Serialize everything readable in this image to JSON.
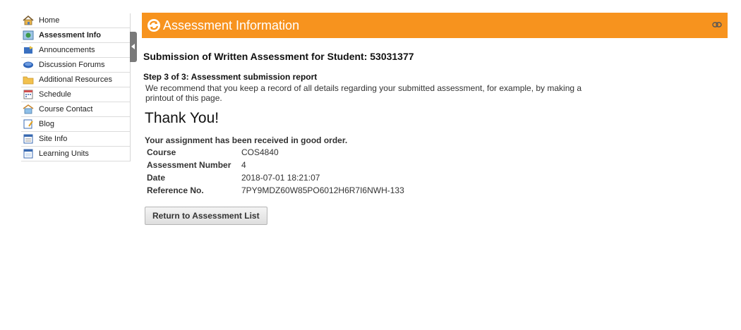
{
  "sidebar": {
    "items": [
      {
        "label": "Home",
        "icon": "home-icon"
      },
      {
        "label": "Assessment Info",
        "icon": "assessment-icon",
        "active": true
      },
      {
        "label": "Announcements",
        "icon": "announcements-icon"
      },
      {
        "label": "Discussion Forums",
        "icon": "forums-icon"
      },
      {
        "label": "Additional Resources",
        "icon": "folder-icon"
      },
      {
        "label": "Schedule",
        "icon": "calendar-icon"
      },
      {
        "label": "Course Contact",
        "icon": "contact-icon"
      },
      {
        "label": "Blog",
        "icon": "blog-icon"
      },
      {
        "label": "Site Info",
        "icon": "info-icon"
      },
      {
        "label": "Learning Units",
        "icon": "units-icon"
      }
    ]
  },
  "header": {
    "title": "Assessment Information",
    "color": "#f7931e"
  },
  "main": {
    "subtitle": "Submission of Written Assessment for Student: 53031377",
    "step": "Step 3 of 3: Assessment submission report",
    "recommend": "We recommend that you keep a record of all details regarding your submitted assessment, for example, by making a printout of this page.",
    "thankyou": "Thank You!",
    "received": "Your assignment has been received in good order.",
    "details": [
      {
        "label": "Course",
        "value": "COS4840"
      },
      {
        "label": "Assessment Number",
        "value": "4"
      },
      {
        "label": "Date",
        "value": "2018-07-01 18:21:07"
      },
      {
        "label": "Reference No.",
        "value": "7PY9MDZ60W85PO6012H6R7I6NWH-133"
      }
    ],
    "button_label": "Return to Assessment List"
  }
}
